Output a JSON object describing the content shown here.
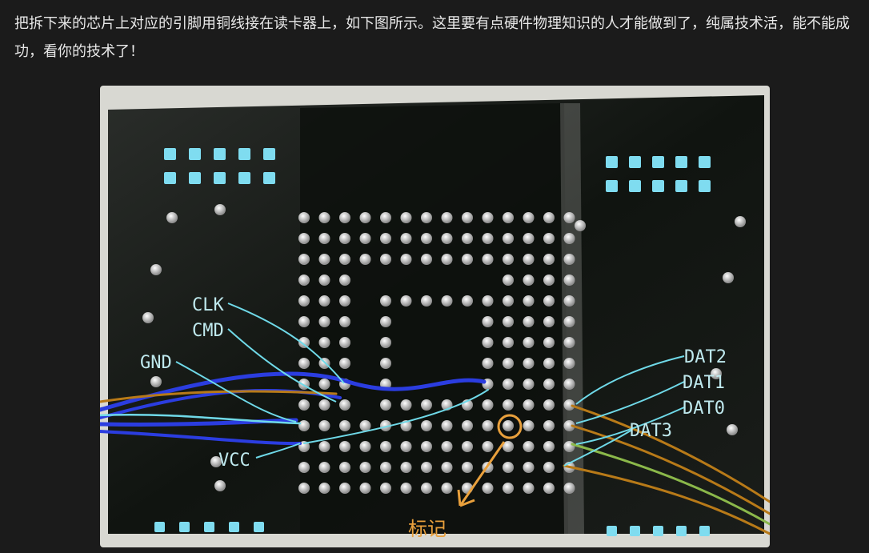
{
  "article": {
    "paragraph": "把拆下来的芯片上对应的引脚用铜线接在读卡器上，如下图所示。这里要有点硬件物理知识的人才能做到了，纯属技术活，能不能成功，看你的技术了！"
  },
  "figure": {
    "pin_labels": {
      "clk": "CLK",
      "cmd": "CMD",
      "gnd": "GND",
      "vcc": "VCC",
      "dat2": "DAT2",
      "dat1": "DAT1",
      "dat0": "DAT0",
      "dat3": "DAT3"
    },
    "marker_label": "标记",
    "colors": {
      "board": "#0f120f",
      "pad": "#d9d9d9",
      "cyan_pad": "#7fdcf0",
      "label": "#bfe9ee",
      "marker": "#e9a03c",
      "wire_blue": "#2b3de0",
      "wire_orange": "#b87a18",
      "wire_teal": "#6fd9e8"
    }
  }
}
